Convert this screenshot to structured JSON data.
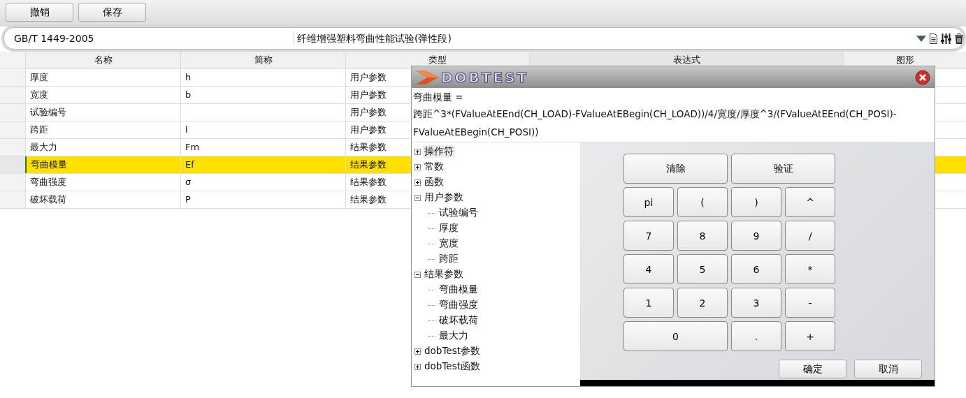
{
  "toolbar": {
    "buttons": [
      "撤销",
      "保存"
    ]
  },
  "standard_bar": {
    "code": "GB/T 1449-2005",
    "title": "纤维增强塑料弯曲性能试验(弹性段)"
  },
  "table": {
    "columns": [
      "名称",
      "简称",
      "类型",
      "表达式",
      "图形"
    ],
    "rows": [
      {
        "name": "厚度",
        "abbr": "h",
        "type": "用户参数",
        "selected": false
      },
      {
        "name": "宽度",
        "abbr": "b",
        "type": "用户参数",
        "selected": false
      },
      {
        "name": "试验编号",
        "abbr": "",
        "type": "用户参数",
        "selected": false
      },
      {
        "name": "跨距",
        "abbr": "l",
        "type": "用户参数",
        "selected": false
      },
      {
        "name": "最大力",
        "abbr": "Fm",
        "type": "结果参数",
        "selected": false
      },
      {
        "name": "弯曲模量",
        "abbr": "Ef",
        "type": "结果参数",
        "selected": true
      },
      {
        "name": "弯曲强度",
        "abbr": "σ",
        "type": "结果参数",
        "selected": false
      },
      {
        "name": "破坏载荷",
        "abbr": "P",
        "type": "结果参数",
        "selected": false
      }
    ]
  },
  "dialog": {
    "logo": "DOBTEST",
    "formula_name": "弯曲模量 =",
    "expression": "跨距^3*(FValueAtEEnd(CH_LOAD)-FValueAtEBegin(CH_LOAD))/4/宽度/厚度^3/(FValueAtEEnd(CH_POSI)-FValueAtEBegin(CH_POSI))",
    "tree": [
      {
        "label": "操作符",
        "expanded": false,
        "selected": true
      },
      {
        "label": "常数",
        "expanded": false,
        "selected": false
      },
      {
        "label": "函数",
        "expanded": false,
        "selected": false
      },
      {
        "label": "用户参数",
        "expanded": true,
        "selected": false,
        "children": [
          {
            "label": "试验编号",
            "selected": false
          },
          {
            "label": "厚度",
            "selected": false
          },
          {
            "label": "宽度",
            "selected": false
          },
          {
            "label": "跨距",
            "selected": false
          }
        ]
      },
      {
        "label": "结果参数",
        "expanded": true,
        "selected": false,
        "children": [
          {
            "label": "弯曲模量",
            "selected": false
          },
          {
            "label": "弯曲强度",
            "selected": false
          },
          {
            "label": "破坏载荷",
            "selected": false
          },
          {
            "label": "最大力",
            "selected": false
          }
        ]
      },
      {
        "label": "dobTest参数",
        "expanded": false,
        "selected": false
      },
      {
        "label": "dobTest函数",
        "expanded": false,
        "selected": false
      }
    ],
    "keys": [
      {
        "label": "清除",
        "wide": true
      },
      {
        "label": "验证",
        "wide": true
      },
      {
        "label": "pi",
        "wide": false
      },
      {
        "label": "(",
        "wide": false
      },
      {
        "label": ")",
        "wide": false
      },
      {
        "label": "^",
        "wide": false
      },
      {
        "label": "7",
        "wide": false
      },
      {
        "label": "8",
        "wide": false
      },
      {
        "label": "9",
        "wide": false
      },
      {
        "label": "/",
        "wide": false
      },
      {
        "label": "4",
        "wide": false
      },
      {
        "label": "5",
        "wide": false
      },
      {
        "label": "6",
        "wide": false
      },
      {
        "label": "*",
        "wide": false
      },
      {
        "label": "1",
        "wide": false
      },
      {
        "label": "2",
        "wide": false
      },
      {
        "label": "3",
        "wide": false
      },
      {
        "label": "-",
        "wide": false
      },
      {
        "label": "0",
        "wide": true
      },
      {
        "label": ".",
        "wide": false
      },
      {
        "label": "+",
        "wide": false
      }
    ],
    "buttons": [
      "确定",
      "取消"
    ]
  }
}
